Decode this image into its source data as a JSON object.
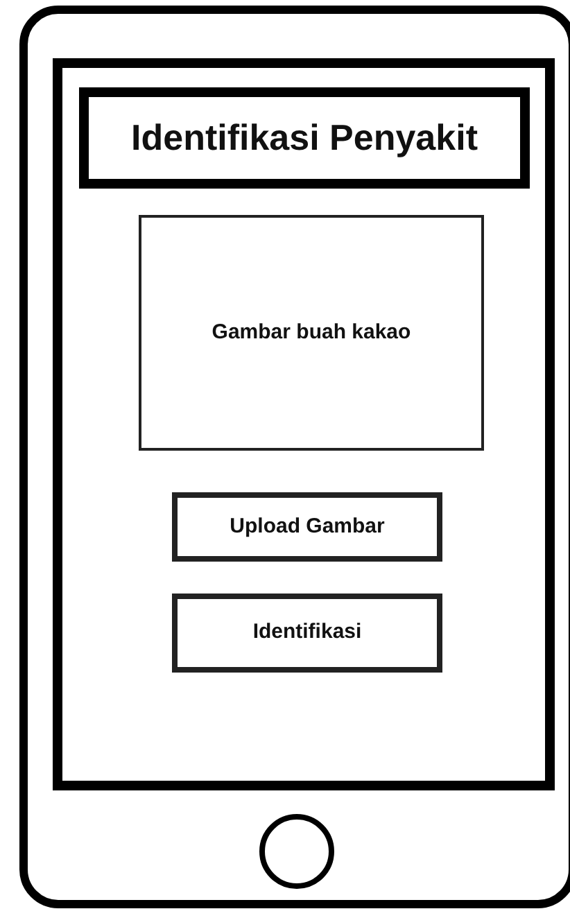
{
  "title": "Identifikasi Penyakit",
  "image_box": {
    "label": "Gambar buah kakao"
  },
  "buttons": [
    {
      "label": "Upload Gambar"
    },
    {
      "label": "Identifikasi"
    }
  ]
}
